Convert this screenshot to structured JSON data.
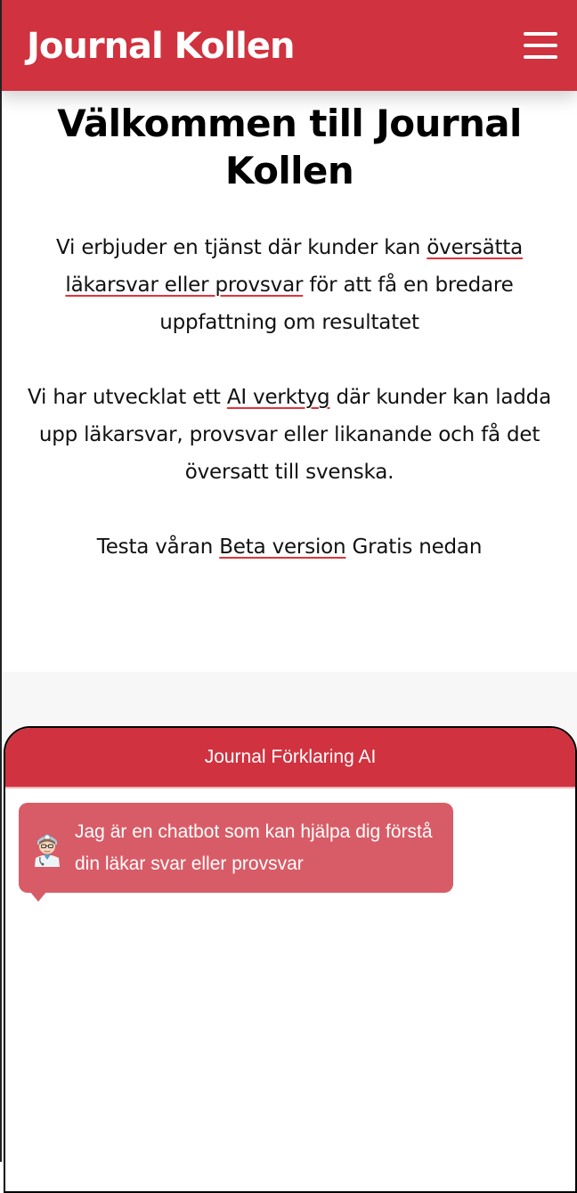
{
  "header": {
    "brand": "Journal Kollen",
    "menu_icon": "hamburger-menu-icon",
    "background_color": "#d0323f"
  },
  "hero": {
    "title": "Välkommen till Journal Kollen",
    "paragraph1": {
      "before": "Vi erbjuder en tjänst där kunder kan ",
      "link": "översätta läkarsvar eller provsvar",
      "after": " för att få en bredare uppfattning om resultatet"
    },
    "paragraph2": {
      "before": "Vi har utvecklat ett ",
      "link": "AI verktyg",
      "after": " där kunder kan ladda upp läkarsvar, provsvar eller likanande och få det översatt till svenska."
    },
    "paragraph3": {
      "before": "Testa våran ",
      "link": "Beta version",
      "after": " Gratis nedan"
    },
    "link_underline_color": "#e0333e"
  },
  "chat": {
    "title": "Journal Förklaring AI",
    "avatar_icon": "doctor-avatar-icon",
    "messages": [
      {
        "sender": "bot",
        "text": "Jag är en chatbot som kan hjälpa dig förstå din läkar svar eller provsvar"
      }
    ],
    "header_color": "#d0323f",
    "bubble_color": "#d85c67"
  }
}
